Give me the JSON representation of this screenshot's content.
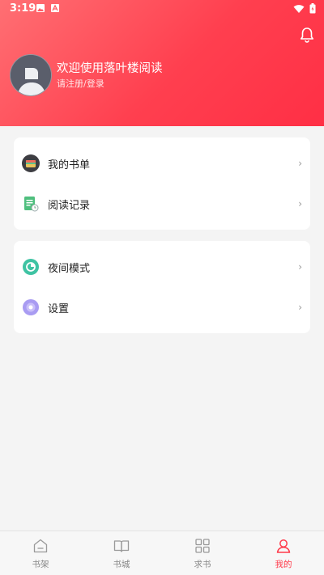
{
  "status_bar": {
    "time": "3:19"
  },
  "profile": {
    "welcome": "欢迎使用落叶楼阅读",
    "login_prompt": "请注册/登录"
  },
  "menu_group_1": [
    {
      "label": "我的书单",
      "icon": "booklist-icon"
    },
    {
      "label": "阅读记录",
      "icon": "reading-record-icon"
    }
  ],
  "menu_group_2": [
    {
      "label": "夜间模式",
      "icon": "night-mode-icon"
    },
    {
      "label": "设置",
      "icon": "settings-icon"
    }
  ],
  "tabs": [
    {
      "label": "书架",
      "icon": "bookshelf-icon",
      "active": false
    },
    {
      "label": "书城",
      "icon": "book-city-icon",
      "active": false
    },
    {
      "label": "求书",
      "icon": "request-book-icon",
      "active": false
    },
    {
      "label": "我的",
      "icon": "profile-icon",
      "active": true
    }
  ],
  "colors": {
    "accent": "#ff3a4a",
    "header_start": "#ff6f73",
    "header_end": "#ff2f45",
    "background": "#f4f4f4"
  }
}
